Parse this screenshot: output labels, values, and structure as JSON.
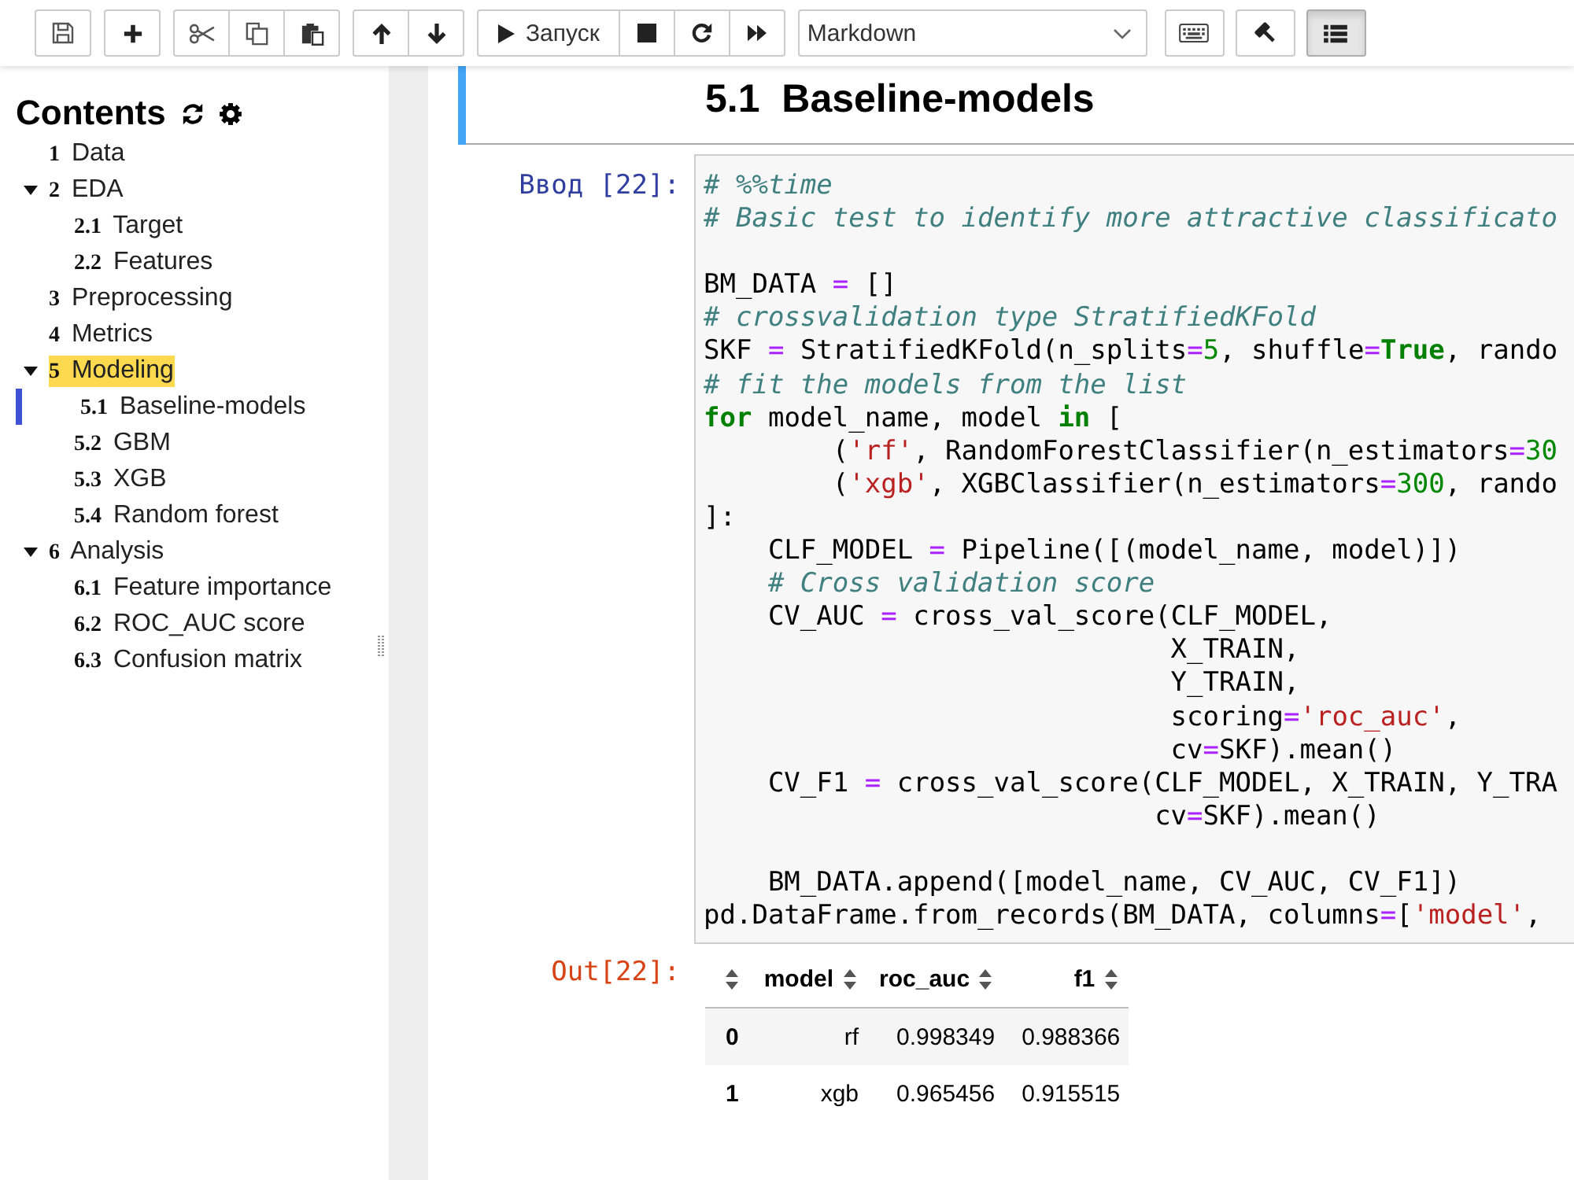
{
  "toolbar": {
    "groups": [
      {
        "buttons": [
          {
            "kind": "save",
            "pressed": false
          }
        ]
      },
      {
        "buttons": [
          {
            "kind": "add",
            "pressed": false
          }
        ]
      },
      {
        "buttons": [
          {
            "kind": "cut",
            "pressed": false
          },
          {
            "kind": "copy",
            "pressed": false
          },
          {
            "kind": "paste",
            "pressed": false
          }
        ]
      },
      {
        "buttons": [
          {
            "kind": "up",
            "pressed": false
          },
          {
            "kind": "down",
            "pressed": false
          }
        ]
      },
      {
        "buttons": [
          {
            "kind": "run",
            "label": "Запуск",
            "pressed": false
          },
          {
            "kind": "stop",
            "pressed": false
          },
          {
            "kind": "restart",
            "pressed": false
          },
          {
            "kind": "forward",
            "pressed": false
          }
        ]
      }
    ],
    "cell_type": {
      "value": "Markdown"
    },
    "tools": [
      {
        "kind": "keyboard",
        "pressed": false
      },
      {
        "kind": "build",
        "pressed": false
      },
      {
        "kind": "toc",
        "pressed": true
      }
    ]
  },
  "toc": {
    "title": "Contents",
    "items": [
      {
        "number": "1",
        "label": "Data",
        "highlighted": false,
        "selected": false
      },
      {
        "number": "2",
        "label": "EDA",
        "expanded": true,
        "highlighted": false,
        "selected": false,
        "children": [
          {
            "number": "2.1",
            "label": "Target",
            "highlighted": false,
            "selected": false
          },
          {
            "number": "2.2",
            "label": "Features",
            "highlighted": false,
            "selected": false
          }
        ]
      },
      {
        "number": "3",
        "label": "Preprocessing",
        "highlighted": false,
        "selected": false
      },
      {
        "number": "4",
        "label": "Metrics",
        "highlighted": false,
        "selected": false
      },
      {
        "number": "5",
        "label": "Modeling",
        "expanded": true,
        "highlighted": true,
        "selected": false,
        "children": [
          {
            "number": "5.1",
            "label": "Baseline-models",
            "highlighted": false,
            "selected": true
          },
          {
            "number": "5.2",
            "label": "GBM",
            "highlighted": false,
            "selected": false
          },
          {
            "number": "5.3",
            "label": "XGB",
            "highlighted": false,
            "selected": false
          },
          {
            "number": "5.4",
            "label": "Random forest",
            "highlighted": false,
            "selected": false
          }
        ]
      },
      {
        "number": "6",
        "label": "Analysis",
        "expanded": true,
        "highlighted": false,
        "selected": false,
        "children": [
          {
            "number": "6.1",
            "label": "Feature importance",
            "highlighted": false,
            "selected": false
          },
          {
            "number": "6.2",
            "label": "ROC_AUC score",
            "highlighted": false,
            "selected": false
          },
          {
            "number": "6.3",
            "label": "Confusion matrix",
            "highlighted": false,
            "selected": false
          }
        ]
      }
    ]
  },
  "notebook": {
    "cells": [
      {
        "kind": "markdown",
        "selected": true,
        "heading": "5.1  Baseline-models"
      },
      {
        "kind": "code",
        "selected": false,
        "prompt": "Ввод [22]:",
        "lines": [
          {
            "kind": "code",
            "tokens": [
              {
                "kind": "comment",
                "text": "# %%time"
              }
            ]
          },
          {
            "kind": "code",
            "tokens": [
              {
                "kind": "comment",
                "text": "# Basic test to identify more attractive classificato"
              }
            ]
          },
          {
            "kind": "blank"
          },
          {
            "kind": "code",
            "tokens": [
              {
                "kind": "text",
                "text": "BM_DATA "
              },
              {
                "kind": "operator",
                "text": "="
              },
              {
                "kind": "text",
                "text": " []"
              }
            ]
          },
          {
            "kind": "code",
            "tokens": [
              {
                "kind": "comment",
                "text": "# crossvalidation type StratifiedKFold"
              }
            ]
          },
          {
            "kind": "code",
            "tokens": [
              {
                "kind": "text",
                "text": "SKF "
              },
              {
                "kind": "operator",
                "text": "="
              },
              {
                "kind": "text",
                "text": " StratifiedKFold(n_splits"
              },
              {
                "kind": "operator",
                "text": "="
              },
              {
                "kind": "number",
                "text": "5"
              },
              {
                "kind": "text",
                "text": ", shuffle"
              },
              {
                "kind": "operator",
                "text": "="
              },
              {
                "kind": "keyword",
                "text": "True"
              },
              {
                "kind": "text",
                "text": ", rando"
              }
            ]
          },
          {
            "kind": "code",
            "tokens": [
              {
                "kind": "comment",
                "text": "# fit the models from the list"
              }
            ]
          },
          {
            "kind": "code",
            "tokens": [
              {
                "kind": "keyword",
                "text": "for"
              },
              {
                "kind": "text",
                "text": " model_name, model "
              },
              {
                "kind": "keyword",
                "text": "in"
              },
              {
                "kind": "text",
                "text": " ["
              }
            ]
          },
          {
            "kind": "code",
            "tokens": [
              {
                "kind": "text",
                "text": "        ("
              },
              {
                "kind": "string",
                "text": "'rf'"
              },
              {
                "kind": "text",
                "text": ", RandomForestClassifier(n_estimators"
              },
              {
                "kind": "operator",
                "text": "="
              },
              {
                "kind": "number",
                "text": "30"
              }
            ]
          },
          {
            "kind": "code",
            "tokens": [
              {
                "kind": "text",
                "text": "        ("
              },
              {
                "kind": "string",
                "text": "'xgb'"
              },
              {
                "kind": "text",
                "text": ", XGBClassifier(n_estimators"
              },
              {
                "kind": "operator",
                "text": "="
              },
              {
                "kind": "number",
                "text": "300"
              },
              {
                "kind": "text",
                "text": ", rando"
              }
            ]
          },
          {
            "kind": "code",
            "tokens": [
              {
                "kind": "text",
                "text": "]:"
              }
            ]
          },
          {
            "kind": "code",
            "tokens": [
              {
                "kind": "text",
                "text": "    CLF_MODEL "
              },
              {
                "kind": "operator",
                "text": "="
              },
              {
                "kind": "text",
                "text": " Pipeline([(model_name, model)])"
              }
            ]
          },
          {
            "kind": "code",
            "tokens": [
              {
                "kind": "comment",
                "text": "    # Cross validation score"
              }
            ]
          },
          {
            "kind": "code",
            "tokens": [
              {
                "kind": "text",
                "text": "    CV_AUC "
              },
              {
                "kind": "operator",
                "text": "="
              },
              {
                "kind": "text",
                "text": " cross_val_score(CLF_MODEL,"
              }
            ]
          },
          {
            "kind": "code",
            "tokens": [
              {
                "kind": "text",
                "text": "                             X_TRAIN,"
              }
            ]
          },
          {
            "kind": "code",
            "tokens": [
              {
                "kind": "text",
                "text": "                             Y_TRAIN,"
              }
            ]
          },
          {
            "kind": "code",
            "tokens": [
              {
                "kind": "text",
                "text": "                             scoring"
              },
              {
                "kind": "operator",
                "text": "="
              },
              {
                "kind": "string",
                "text": "'roc_auc'"
              },
              {
                "kind": "text",
                "text": ","
              }
            ]
          },
          {
            "kind": "code",
            "tokens": [
              {
                "kind": "text",
                "text": "                             cv"
              },
              {
                "kind": "operator",
                "text": "="
              },
              {
                "kind": "text",
                "text": "SKF).mean()"
              }
            ]
          },
          {
            "kind": "code",
            "tokens": [
              {
                "kind": "text",
                "text": "    CV_F1 "
              },
              {
                "kind": "operator",
                "text": "="
              },
              {
                "kind": "text",
                "text": " cross_val_score(CLF_MODEL, X_TRAIN, Y_TRA"
              }
            ]
          },
          {
            "kind": "code",
            "tokens": [
              {
                "kind": "text",
                "text": "                            cv"
              },
              {
                "kind": "operator",
                "text": "="
              },
              {
                "kind": "text",
                "text": "SKF).mean()"
              }
            ]
          },
          {
            "kind": "blank"
          },
          {
            "kind": "code",
            "tokens": [
              {
                "kind": "text",
                "text": "    BM_DATA.append([model_name, CV_AUC, CV_F1])"
              }
            ]
          },
          {
            "kind": "code",
            "tokens": [
              {
                "kind": "text",
                "text": "pd.DataFrame.from_records(BM_DATA, columns"
              },
              {
                "kind": "operator",
                "text": "="
              },
              {
                "kind": "text",
                "text": "["
              },
              {
                "kind": "string",
                "text": "'model'"
              },
              {
                "kind": "text",
                "text": ","
              }
            ]
          }
        ],
        "output": {
          "prompt": "Out[22]:",
          "table": {
            "columns": [
              "model",
              "roc_auc",
              "f1"
            ],
            "rows": [
              {
                "index": "0",
                "cells": [
                  "rf",
                  "0.998349",
                  "0.988366"
                ]
              },
              {
                "index": "1",
                "cells": [
                  "xgb",
                  "0.965456",
                  "0.915515"
                ]
              }
            ]
          }
        }
      }
    ]
  }
}
